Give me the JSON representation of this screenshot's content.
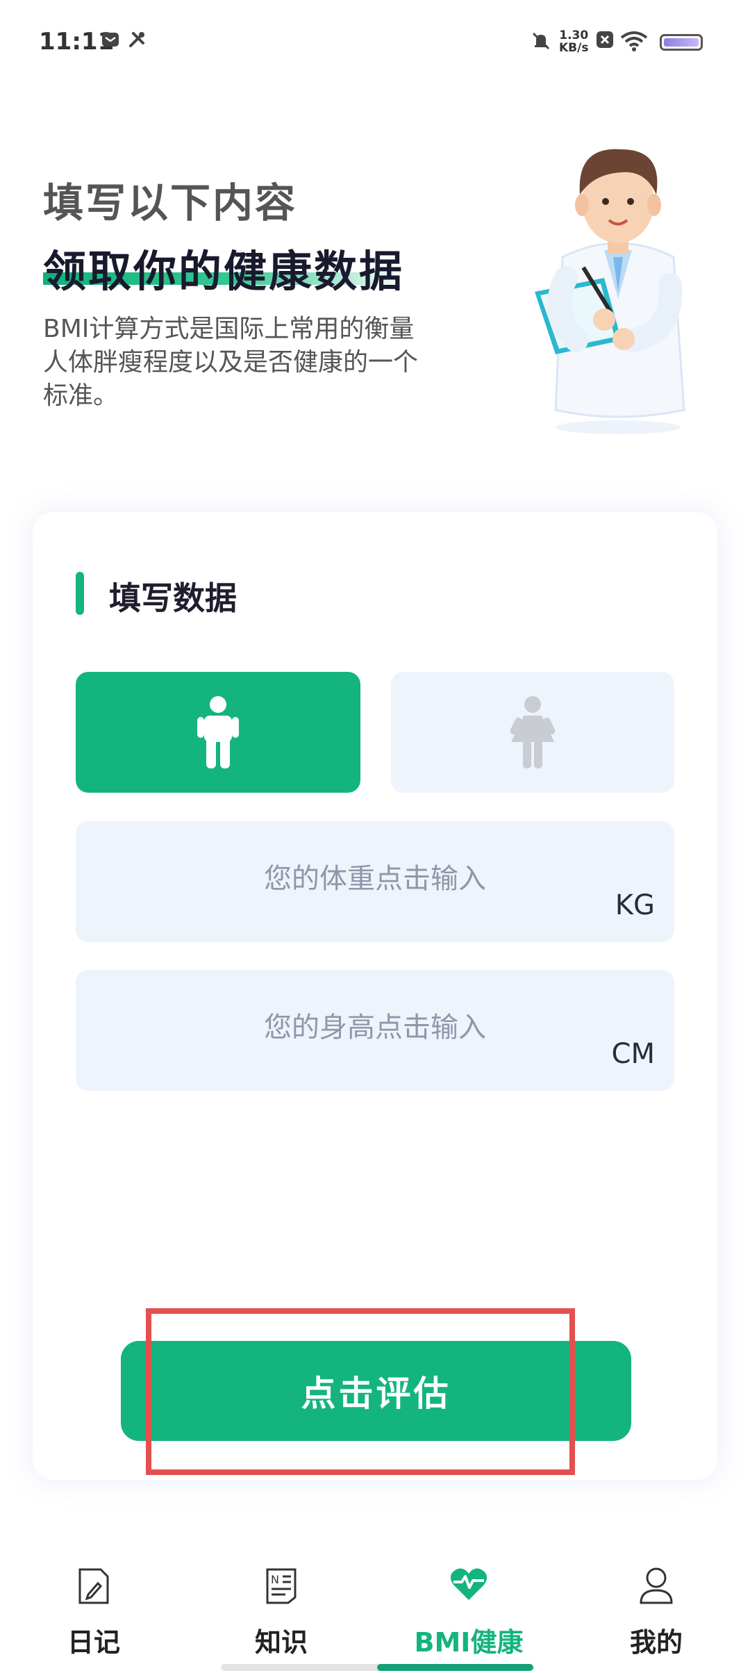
{
  "status_bar": {
    "time": "11:11",
    "speed_value": "1.30",
    "speed_unit": "KB/s",
    "icons": [
      "mail-icon",
      "tools-icon",
      "mute-icon",
      "close-box-icon",
      "wifi-icon",
      "battery-icon"
    ]
  },
  "hero": {
    "title_line1": "填写以下内容",
    "title_line2": "领取你的健康数据",
    "description": "BMI计算方式是国际上常用的衡量人体胖瘦程度以及是否健康的一个标准。"
  },
  "form": {
    "section_title": "填写数据",
    "gender_selected": "male",
    "weight": {
      "placeholder": "您的体重点击输入",
      "unit": "KG",
      "value": ""
    },
    "height": {
      "placeholder": "您的身高点击输入",
      "unit": "CM",
      "value": ""
    },
    "submit_label": "点击评估"
  },
  "bottom_nav": {
    "items": [
      {
        "label": "日记",
        "icon": "diary-icon"
      },
      {
        "label": "知识",
        "icon": "knowledge-icon"
      },
      {
        "label": "BMI健康",
        "icon": "heart-pulse-icon",
        "active": true
      },
      {
        "label": "我的",
        "icon": "profile-icon"
      }
    ]
  },
  "colors": {
    "accent": "#14b47e",
    "field_bg": "#eef4fc",
    "highlight": "#e44f4f"
  }
}
